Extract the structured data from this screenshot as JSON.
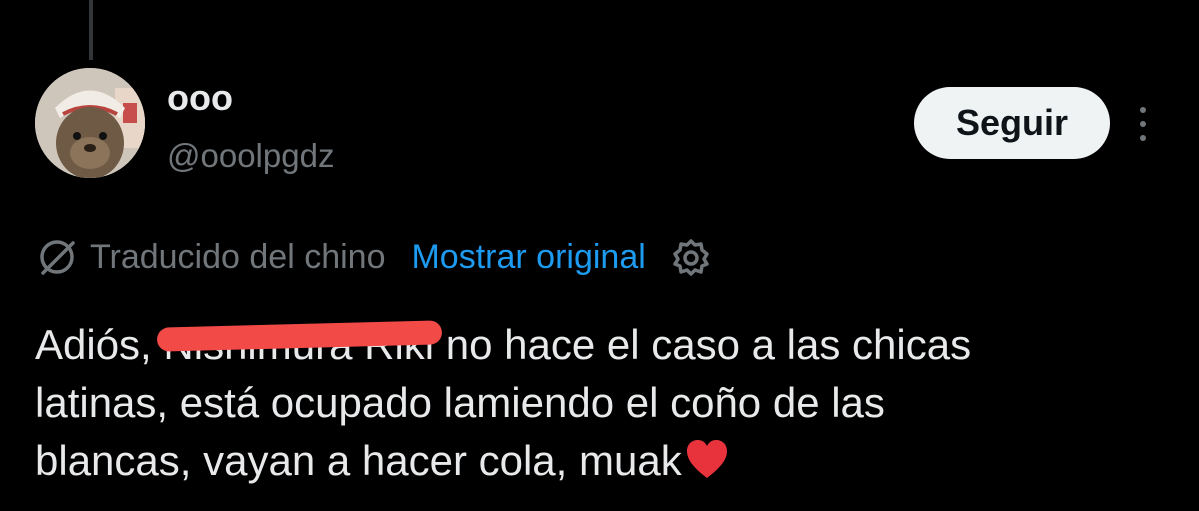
{
  "user": {
    "display_name": "ooo",
    "handle": "@ooolpgdz"
  },
  "actions": {
    "follow_label": "Seguir",
    "more_icon": "more-vertical-icon"
  },
  "translation": {
    "label": "Traducido del chino",
    "show_original": "Mostrar original",
    "icon": "globe-slash-icon",
    "settings_icon": "gear-icon"
  },
  "tweet": {
    "line1_before": "Adiós, ",
    "line1_redacted": "Nishimura Riki",
    "line1_after": " no hace el caso a las chicas",
    "line2": "latinas, está ocupado lamiendo el coño de las",
    "line3": "blancas, vayan a hacer cola, muak",
    "emoji": "red-heart-icon"
  },
  "colors": {
    "background": "#000000",
    "text": "#e7e9ea",
    "secondary": "#71767b",
    "link": "#1d9bf0",
    "redaction": "#f24a47",
    "heart": "#e8333c"
  }
}
